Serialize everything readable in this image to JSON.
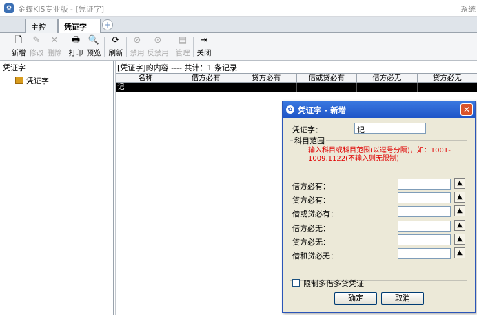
{
  "window": {
    "icon": "kingdee-logo-icon",
    "title": "金蝶KIS专业版 - [凭证字]",
    "right_text": "系统"
  },
  "tabs": [
    {
      "label": "主控台"
    },
    {
      "label": "凭证字",
      "close": "×"
    }
  ],
  "tab_add": "+",
  "toolbar": [
    {
      "label": "新增",
      "icon": "new-doc-icon",
      "glyph": "🗋",
      "enabled": true
    },
    {
      "label": "修改",
      "icon": "edit-icon",
      "glyph": "✎",
      "enabled": false
    },
    {
      "label": "删除",
      "icon": "delete-icon",
      "glyph": "✕",
      "enabled": false
    },
    {
      "label": "打印",
      "icon": "print-icon",
      "glyph": "🖶",
      "enabled": true
    },
    {
      "label": "预览",
      "icon": "preview-icon",
      "glyph": "🔍",
      "enabled": true
    },
    {
      "label": "刷新",
      "icon": "refresh-icon",
      "glyph": "⟳",
      "enabled": true
    },
    {
      "label": "禁用",
      "icon": "disable-icon",
      "glyph": "⊘",
      "enabled": false
    },
    {
      "label": "反禁用",
      "icon": "enable-icon",
      "glyph": "⊙",
      "enabled": false
    },
    {
      "label": "管理",
      "icon": "manage-icon",
      "glyph": "▤",
      "enabled": false
    },
    {
      "label": "关闭",
      "icon": "close-door-icon",
      "glyph": "⇥",
      "enabled": true
    }
  ],
  "left_pane": {
    "header": "凭证字",
    "tree_item": "凭证字"
  },
  "grid": {
    "caption": "[凭证字]的内容 ---- 共计：1 条记录",
    "columns": [
      "名称",
      "借方必有",
      "贷方必有",
      "借或贷必有",
      "借方必无",
      "贷方必无"
    ],
    "rows": [
      [
        "记",
        "",
        "",
        "",
        "",
        ""
      ]
    ]
  },
  "dialog": {
    "title": "凭证字 - 新增",
    "close": "✕",
    "voucher_label": "凭证字：",
    "voucher_value": "记",
    "group_title": "科目范围",
    "hint": "输入科目或科目范围(以逗号分隔)，如：1001-1009,1122(不输入则无限制)",
    "fields": [
      {
        "label": "借方必有：",
        "value": ""
      },
      {
        "label": "贷方必有：",
        "value": ""
      },
      {
        "label": "借或贷必有：",
        "value": ""
      },
      {
        "label": "借方必无：",
        "value": ""
      },
      {
        "label": "贷方必无：",
        "value": ""
      },
      {
        "label": "借和贷必无：",
        "value": ""
      }
    ],
    "checkbox_label": "限制多借多贷凭证",
    "checkbox_checked": false,
    "ok": "确定",
    "cancel": "取消"
  },
  "colors": {
    "accent": "#1f55c8",
    "hint_red": "#e00000",
    "row_selected": "#000000"
  }
}
